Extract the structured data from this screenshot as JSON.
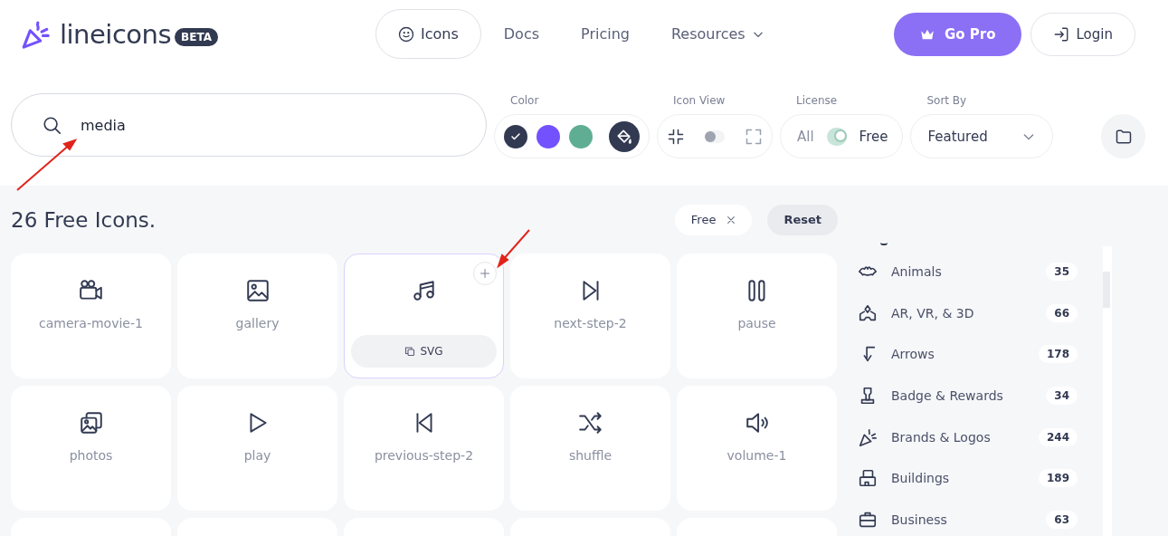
{
  "header": {
    "logo": "lineicons",
    "badge": "BETA",
    "nav": [
      {
        "label": "Icons",
        "selected": true,
        "kind": "icon"
      },
      {
        "label": "Docs",
        "selected": false,
        "kind": "plain"
      },
      {
        "label": "Pricing",
        "selected": false,
        "kind": "plain"
      },
      {
        "label": "Resources",
        "selected": false,
        "kind": "menu"
      }
    ],
    "pro_button": "Go Pro",
    "login_button": "Login"
  },
  "search": {
    "value": "media"
  },
  "filters": {
    "color_label": "Color",
    "swatches": [
      {
        "color": "#323a52",
        "selected": true
      },
      {
        "color": "#7451ff",
        "selected": false
      },
      {
        "color": "#5fae93",
        "selected": false
      }
    ],
    "view_label": "Icon View",
    "view_toggle": {
      "on": false
    },
    "license_label": "License",
    "license_all": "All",
    "license_free": "Free",
    "license_toggle": {
      "on": true
    },
    "sort_label": "Sort By",
    "sort_value": "Featured"
  },
  "results": {
    "title": "26 Free Icons.",
    "chips": [
      {
        "label": "Free",
        "kind": "removable"
      },
      {
        "label": "Reset",
        "kind": "button"
      }
    ],
    "cards": [
      {
        "name": "camera-movie-1",
        "hovered": false
      },
      {
        "name": "gallery",
        "hovered": false
      },
      {
        "hovered": true,
        "copy_label": "SVG"
      },
      {
        "name": "next-step-2",
        "hovered": false
      },
      {
        "name": "pause",
        "hovered": false
      },
      {
        "name": "photos",
        "hovered": false
      },
      {
        "name": "play",
        "hovered": false
      },
      {
        "name": "previous-step-2",
        "hovered": false
      },
      {
        "name": "shuffle",
        "hovered": false
      },
      {
        "name": "volume-1",
        "hovered": false
      }
    ]
  },
  "categories": [
    {
      "label": "Animals",
      "count": "35"
    },
    {
      "label": "AR, VR, & 3D",
      "count": "66"
    },
    {
      "label": "Arrows",
      "count": "178"
    },
    {
      "label": "Badge & Rewards",
      "count": "34"
    },
    {
      "label": "Brands & Logos",
      "count": "244"
    },
    {
      "label": "Buildings",
      "count": "189"
    },
    {
      "label": "Business",
      "count": "63"
    }
  ]
}
